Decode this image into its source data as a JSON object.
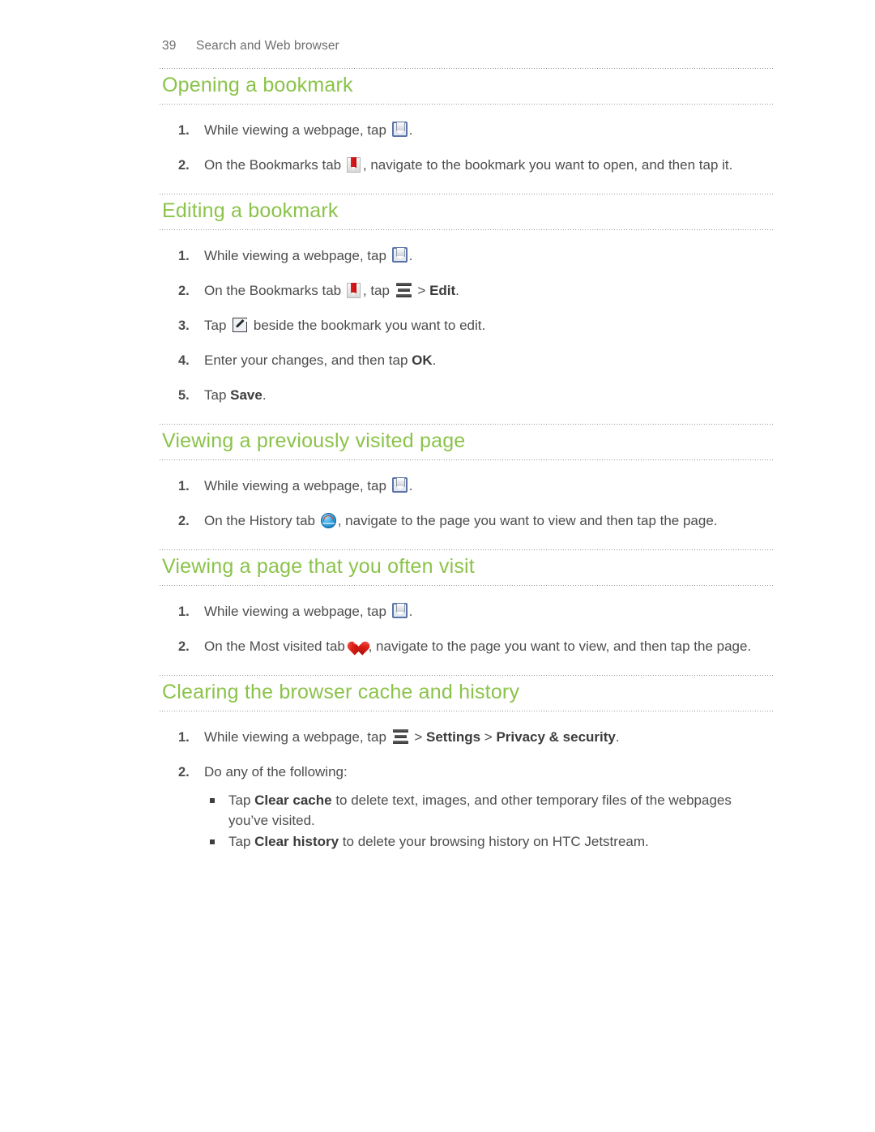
{
  "running_head": {
    "page_number": "39",
    "chapter": "Search and Web browser"
  },
  "theme": {
    "heading_green": "#8bc34a",
    "body_gray": "#4d4d4d",
    "rule_gray": "#9a9a9a"
  },
  "sections": [
    {
      "id": "opening-a-bookmark",
      "heading": "Opening a bookmark",
      "steps": [
        {
          "num": "1.",
          "parts": [
            {
              "t": "text",
              "v": "While viewing a webpage, tap "
            },
            {
              "t": "icon",
              "v": "bookmarks-icon"
            },
            {
              "t": "text",
              "v": "."
            }
          ]
        },
        {
          "num": "2.",
          "parts": [
            {
              "t": "text",
              "v": "On the Bookmarks tab "
            },
            {
              "t": "icon",
              "v": "bookmark-tab-icon"
            },
            {
              "t": "text",
              "v": ", navigate to the bookmark you want to open, and then tap it."
            }
          ]
        }
      ]
    },
    {
      "id": "editing-a-bookmark",
      "heading": "Editing a bookmark",
      "steps": [
        {
          "num": "1.",
          "parts": [
            {
              "t": "text",
              "v": "While viewing a webpage, tap "
            },
            {
              "t": "icon",
              "v": "bookmarks-icon"
            },
            {
              "t": "text",
              "v": "."
            }
          ]
        },
        {
          "num": "2.",
          "parts": [
            {
              "t": "text",
              "v": "On the Bookmarks tab "
            },
            {
              "t": "icon",
              "v": "bookmark-tab-icon"
            },
            {
              "t": "text",
              "v": ", tap "
            },
            {
              "t": "icon",
              "v": "menu-icon"
            },
            {
              "t": "text",
              "v": " > "
            },
            {
              "t": "bold",
              "v": "Edit"
            },
            {
              "t": "text",
              "v": "."
            }
          ]
        },
        {
          "num": "3.",
          "parts": [
            {
              "t": "text",
              "v": "Tap "
            },
            {
              "t": "icon",
              "v": "edit-icon"
            },
            {
              "t": "text",
              "v": " beside the bookmark you want to edit."
            }
          ]
        },
        {
          "num": "4.",
          "parts": [
            {
              "t": "text",
              "v": "Enter your changes, and then tap "
            },
            {
              "t": "bold",
              "v": "OK"
            },
            {
              "t": "text",
              "v": "."
            }
          ]
        },
        {
          "num": "5.",
          "parts": [
            {
              "t": "text",
              "v": "Tap "
            },
            {
              "t": "bold",
              "v": "Save"
            },
            {
              "t": "text",
              "v": "."
            }
          ]
        }
      ]
    },
    {
      "id": "viewing-a-previously-visited-page",
      "heading": "Viewing a previously visited page",
      "steps": [
        {
          "num": "1.",
          "parts": [
            {
              "t": "text",
              "v": "While viewing a webpage, tap "
            },
            {
              "t": "icon",
              "v": "bookmarks-icon"
            },
            {
              "t": "text",
              "v": "."
            }
          ]
        },
        {
          "num": "2.",
          "parts": [
            {
              "t": "text",
              "v": "On the History tab "
            },
            {
              "t": "icon",
              "v": "history-icon"
            },
            {
              "t": "text",
              "v": ", navigate to the page you want to view and then tap the page."
            }
          ]
        }
      ]
    },
    {
      "id": "viewing-a-page-that-you-often-visit",
      "heading": "Viewing a page that you often visit",
      "steps": [
        {
          "num": "1.",
          "parts": [
            {
              "t": "text",
              "v": "While viewing a webpage, tap "
            },
            {
              "t": "icon",
              "v": "bookmarks-icon"
            },
            {
              "t": "text",
              "v": "."
            }
          ]
        },
        {
          "num": "2.",
          "parts": [
            {
              "t": "text",
              "v": "On the Most visited tab "
            },
            {
              "t": "icon",
              "v": "heart-icon"
            },
            {
              "t": "text",
              "v": ", navigate to the page you want to view, and then tap the page."
            }
          ]
        }
      ]
    },
    {
      "id": "clearing-the-browser-cache-and-history",
      "heading": "Clearing the browser cache and history",
      "steps": [
        {
          "num": "1.",
          "parts": [
            {
              "t": "text",
              "v": "While viewing a webpage, tap "
            },
            {
              "t": "icon",
              "v": "menu-icon"
            },
            {
              "t": "text",
              "v": " > "
            },
            {
              "t": "bold",
              "v": "Settings"
            },
            {
              "t": "text",
              "v": " > "
            },
            {
              "t": "bold",
              "v": "Privacy & security"
            },
            {
              "t": "text",
              "v": "."
            }
          ]
        },
        {
          "num": "2.",
          "parts": [
            {
              "t": "text",
              "v": "Do any of the following:"
            }
          ],
          "bullets": [
            {
              "parts": [
                {
                  "t": "text",
                  "v": "Tap "
                },
                {
                  "t": "bold",
                  "v": "Clear cache"
                },
                {
                  "t": "text",
                  "v": " to delete text, images, and other temporary files of the webpages you’ve visited."
                }
              ]
            },
            {
              "parts": [
                {
                  "t": "text",
                  "v": "Tap "
                },
                {
                  "t": "bold",
                  "v": "Clear history"
                },
                {
                  "t": "text",
                  "v": " to delete your browsing history on HTC Jetstream."
                }
              ]
            }
          ]
        }
      ]
    }
  ]
}
